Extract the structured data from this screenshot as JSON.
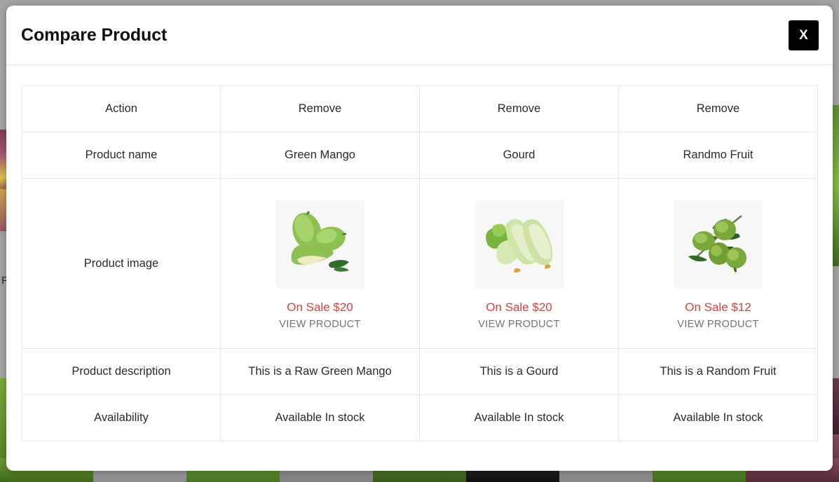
{
  "modal": {
    "title": "Compare Product",
    "close_label": "X",
    "close_icon": "close-x-icon"
  },
  "table": {
    "row_labels": [
      "Action",
      "Product name",
      "Product image",
      "Product description",
      "Availability"
    ],
    "products": [
      {
        "action": "Remove",
        "name": "Green Mango",
        "image_alt": "green-mango-thumbnail",
        "price": "On Sale $20",
        "view_label": "VIEW PRODUCT",
        "description": "This is a Raw Green Mango",
        "availability": "Available In stock"
      },
      {
        "action": "Remove",
        "name": "Gourd",
        "image_alt": "gourd-thumbnail",
        "price": "On Sale $20",
        "view_label": "VIEW PRODUCT",
        "description": "This is a Gourd",
        "availability": "Available In stock"
      },
      {
        "action": "Remove",
        "name": "Randmo Fruit",
        "image_alt": "olive-branch-thumbnail",
        "price": "On Sale $12",
        "view_label": "VIEW PRODUCT",
        "description": "This is a Random Fruit",
        "availability": "Available In stock"
      }
    ]
  },
  "backdrop": {
    "partial_text": "F",
    "overlay_color": "#a3a3a3"
  },
  "colors": {
    "price_red": "#e03c3c",
    "link_gray": "#6c757d",
    "border_gray": "#e6e6e6",
    "header_divider": "#dee2e6",
    "close_bg": "#000000"
  }
}
